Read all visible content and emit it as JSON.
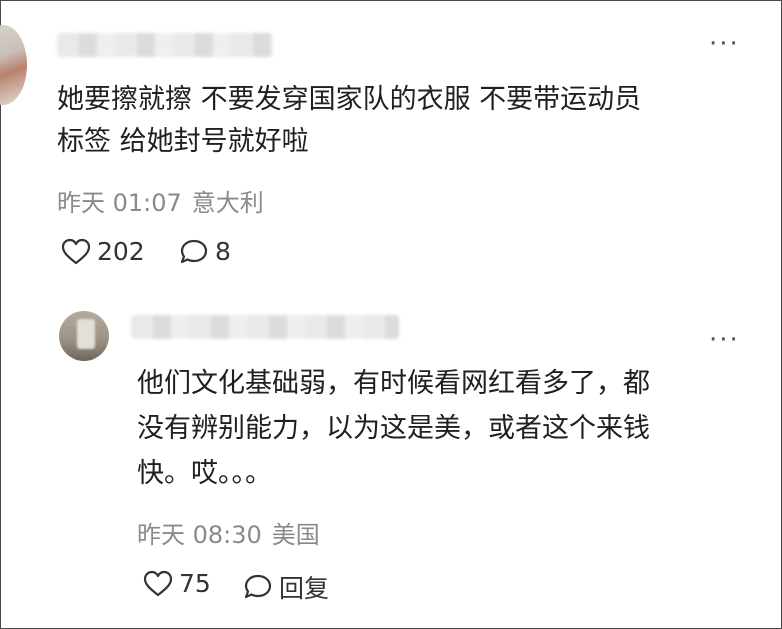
{
  "comment": {
    "text_line1": "她要擦就擦 不要发穿国家队的衣服 不要带运动员",
    "text_line2": "标签 给她封号就好啦",
    "date": "昨天 01:07",
    "location": "意大利",
    "likes": "202",
    "replies": "8",
    "more_icon": "more-dots-icon"
  },
  "reply": {
    "text_line1": "他们文化基础弱，有时候看网红看多了，都",
    "text_line2": "没有辨别能力，以为这是美，或者这个来钱",
    "text_line3": "快。哎。。。",
    "date": "昨天 08:30",
    "location": "美国",
    "likes": "75",
    "reply_label": "回复",
    "more_icon": "more-dots-icon"
  },
  "colors": {
    "text": "#202020",
    "meta": "#8a8a8a",
    "border": "#4a4a4a"
  }
}
